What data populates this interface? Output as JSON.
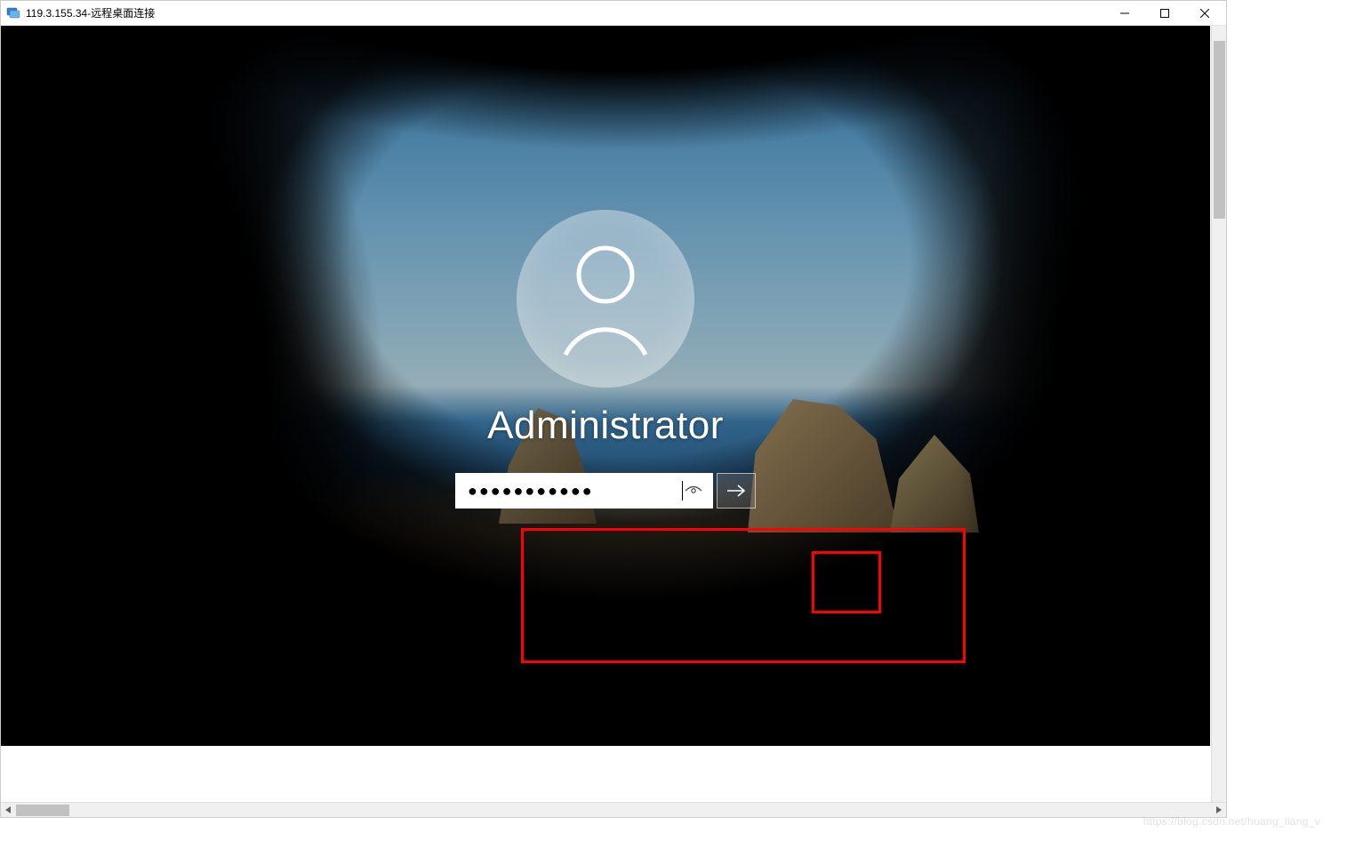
{
  "titlebar": {
    "ip": "119.3.155.34",
    "separator": " - ",
    "app_name": "远程桌面连接"
  },
  "login": {
    "username": "Administrator",
    "password_mask": "●●●●●●●●●●●",
    "password_value_hidden": true
  },
  "icons": {
    "minimize": "—",
    "maximize": "☐",
    "close": "✕",
    "arrow_right": "→",
    "scroll_left": "◀",
    "scroll_right": "▶"
  },
  "colors": {
    "annotation": "#ff0000",
    "titlebar_bg": "#ffffff",
    "login_text": "#ffffff"
  },
  "watermark": "https://blog.csdn.net/huang_liang_v"
}
